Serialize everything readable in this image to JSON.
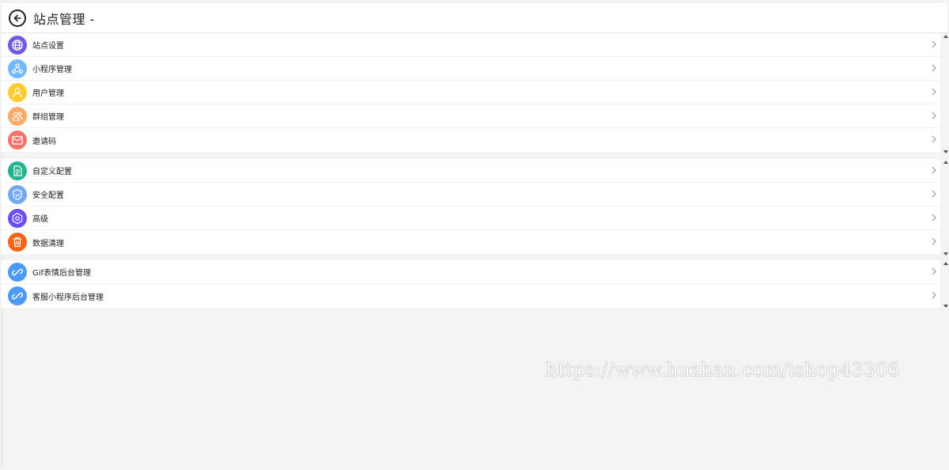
{
  "header": {
    "title": "站点管理 -"
  },
  "groups": [
    {
      "items": [
        {
          "label": "站点设置",
          "icon": "globe-icon",
          "color": "#6c5ce7"
        },
        {
          "label": "小程序管理",
          "icon": "share-icon",
          "color": "#74b9ff"
        },
        {
          "label": "用户管理",
          "icon": "user-icon",
          "color": "#fdcb2e"
        },
        {
          "label": "群组管理",
          "icon": "group-icon",
          "color": "#fdab6a"
        },
        {
          "label": "邀请码",
          "icon": "mail-icon",
          "color": "#f7736b"
        }
      ]
    },
    {
      "items": [
        {
          "label": "自定义配置",
          "icon": "document-icon",
          "color": "#22b48f"
        },
        {
          "label": "安全配置",
          "icon": "shield-icon",
          "color": "#74a9f2"
        },
        {
          "label": "高级",
          "icon": "hexagon-icon",
          "color": "#6c4ff0"
        },
        {
          "label": "数据清理",
          "icon": "trash-icon",
          "color": "#f76413"
        }
      ]
    },
    {
      "items": [
        {
          "label": "Gif表情后台管理",
          "icon": "link-icon",
          "color": "#4c9af7"
        },
        {
          "label": "客服小程序后台管理",
          "icon": "link-icon",
          "color": "#4c9af7"
        }
      ]
    }
  ],
  "watermark": "https://www.huzhan.com/ishop43306"
}
